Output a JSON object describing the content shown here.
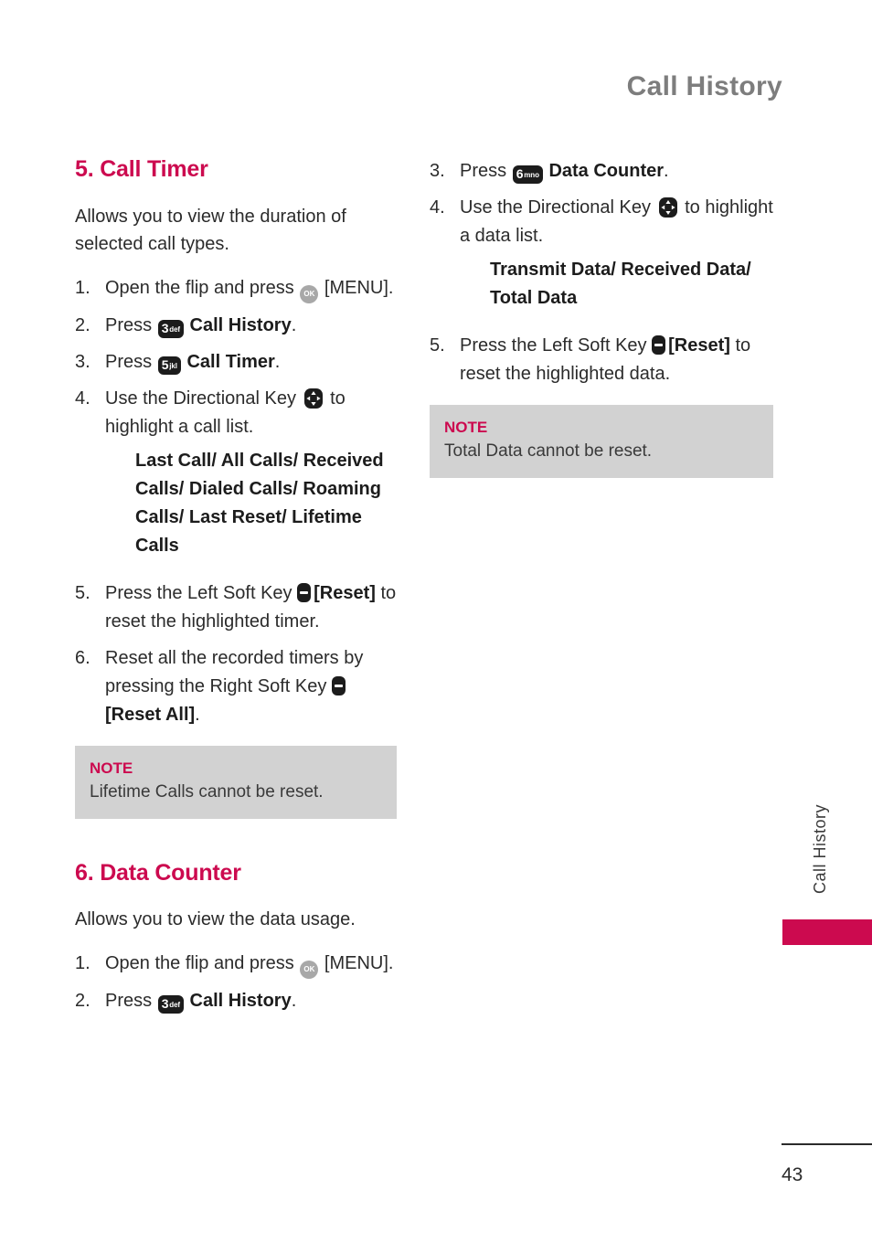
{
  "header": {
    "running_title": "Call History"
  },
  "side_tab": {
    "label": "Call History",
    "accent_color": "#cc0a4f"
  },
  "footer": {
    "page_number": "43"
  },
  "colors": {
    "accent_pink": "#cc0a4f",
    "note_background": "#d2d2d2",
    "header_gray": "#7d7d7d",
    "body_text": "#2b2b2b",
    "keycap_dark": "#1c1c1c",
    "okkey_gray": "#a8a8a8"
  },
  "left_column": {
    "section_1": {
      "heading": "5. Call Timer",
      "intro": "Allows you to view the duration of selected call types.",
      "steps": [
        {
          "num": "1.",
          "before": "Open the flip and press ",
          "icon": "ok-key-icon",
          "icon_label": "OK",
          "after": " [MENU]."
        },
        {
          "num": "2.",
          "before": "Press ",
          "icon": "keypad-3-def-icon",
          "key_digit": "3",
          "key_letters": "def",
          "after_bold": "Call History",
          "after": "."
        },
        {
          "num": "3.",
          "before": "Press ",
          "icon": "keypad-5-jkl-icon",
          "key_digit": "5",
          "key_letters": "jkl",
          "after_bold": "Call Timer",
          "after": "."
        },
        {
          "num": "4.",
          "before": "Use the Directional Key ",
          "icon": "directional-key-icon",
          "after": " to highlight a call list.",
          "sublist": "Last Call/ All Calls/ Received Calls/ Dialed Calls/ Roaming Calls/ Last Reset/ Lifetime Calls"
        },
        {
          "num": "5.",
          "before": "Press the Left Soft Key ",
          "icon": "soft-key-icon",
          "bracket_label": "[Reset]",
          "after": " to reset the highlighted timer."
        },
        {
          "num": "6.",
          "before": "Reset all the recorded timers by pressing the Right Soft Key ",
          "icon": "soft-key-icon",
          "bracket_label": "[Reset All]",
          "after": "."
        }
      ],
      "note": {
        "title": "NOTE",
        "text": "Lifetime Calls cannot be reset."
      }
    },
    "section_2": {
      "heading": "6. Data Counter",
      "intro": "Allows you to view the data usage.",
      "steps": [
        {
          "num": "1.",
          "before": "Open the flip and press ",
          "icon": "ok-key-icon",
          "icon_label": "OK",
          "after": " [MENU]."
        },
        {
          "num": "2.",
          "before": "Press ",
          "icon": "keypad-3-def-icon",
          "key_digit": "3",
          "key_letters": "def",
          "after_bold": "Call History",
          "after": "."
        }
      ]
    }
  },
  "right_column": {
    "steps": [
      {
        "num": "3.",
        "before": "Press ",
        "icon": "keypad-6-mno-icon",
        "key_digit": "6",
        "key_letters": "mno",
        "after_bold": "Data Counter",
        "after": "."
      },
      {
        "num": "4.",
        "before": "Use the Directional Key ",
        "icon": "directional-key-icon",
        "after": " to highlight a data list.",
        "sublist": "Transmit Data/ Received Data/ Total Data"
      },
      {
        "num": "5.",
        "before": "Press the Left Soft Key ",
        "icon": "soft-key-icon",
        "bracket_label": "[Reset]",
        "after": " to reset the highlighted data."
      }
    ],
    "note": {
      "title": "NOTE",
      "text": "Total Data cannot be reset."
    }
  }
}
